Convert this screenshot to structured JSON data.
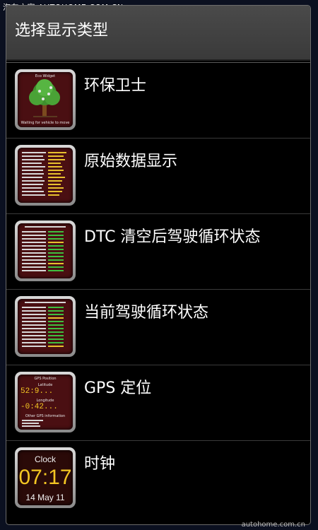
{
  "watermark": {
    "top": "汽车之家  AUTOHOME.COM.CN",
    "bottom": "autohome.com.cn"
  },
  "dialog": {
    "title": "选择显示类型"
  },
  "items": [
    {
      "label": "环保卫士",
      "icon": "eco-widget-tree-icon"
    },
    {
      "label": "原始数据显示",
      "icon": "raw-data-icon"
    },
    {
      "label": "DTC 清空后驾驶循环状态",
      "icon": "drive-status-since-dtc-clear-icon"
    },
    {
      "label": "当前驾驶循环状态",
      "icon": "current-drive-status-icon"
    },
    {
      "label": "GPS 定位",
      "icon": "gps-position-icon"
    },
    {
      "label": "时钟",
      "icon": "clock-icon"
    }
  ],
  "thumbs": {
    "eco": {
      "title": "Eco Widget",
      "caption": "Waiting for vehicle to move"
    },
    "gps": {
      "title": "GPS Position",
      "latitude_label": "Latitude",
      "latitude": "52:9...",
      "longitude_label": "Longitude",
      "longitude": "-0:42...",
      "other": "Other GPS information"
    },
    "clock": {
      "label": "Clock",
      "time": "07:17",
      "date": "14 May 11"
    }
  },
  "colors": {
    "dialog_header": "#404040",
    "list_bg": "#000000",
    "accent_yellow": "#f3c623",
    "thumb_bg": "#4a0f12"
  }
}
